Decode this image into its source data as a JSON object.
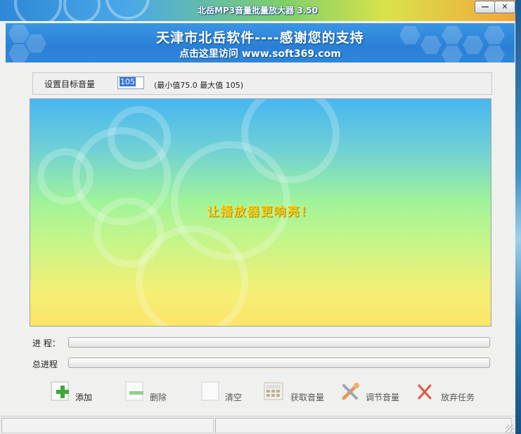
{
  "window": {
    "title": "北岳MP3音量批量放大器   3.50",
    "minimize_label": "—",
    "close_label": "✕"
  },
  "banner": {
    "title": "天津市北岳软件----感谢您的支持",
    "link": "点击这里访问 www.soft369.com"
  },
  "settings": {
    "label": "设置目标音量",
    "value": "105",
    "range_text": "(最小值75.0  最大值 105)"
  },
  "display": {
    "slogan": "让播放器更响亮！"
  },
  "progress": {
    "file_label": "进  程：",
    "total_label": "总进程",
    "file_progress": 0,
    "total_progress": 0
  },
  "toolbar": {
    "add_label": "添加",
    "delete_label": "删除",
    "clear_label": "清空",
    "get_volume_label": "获取音量",
    "adjust_volume_label": "调节音量",
    "abort_label": "放弃任务",
    "icons": [
      "plus-icon",
      "minus-icon",
      "blank-page-icon",
      "calculator-icon",
      "tools-icon",
      "cancel-x-icon"
    ]
  },
  "colors": {
    "title_gradient_start": "#2e88d6",
    "banner_blue": "#2a80d6",
    "slogan_yellow": "#f4d11c",
    "add_green": "#3da83a",
    "cancel_red": "#e0553d"
  }
}
